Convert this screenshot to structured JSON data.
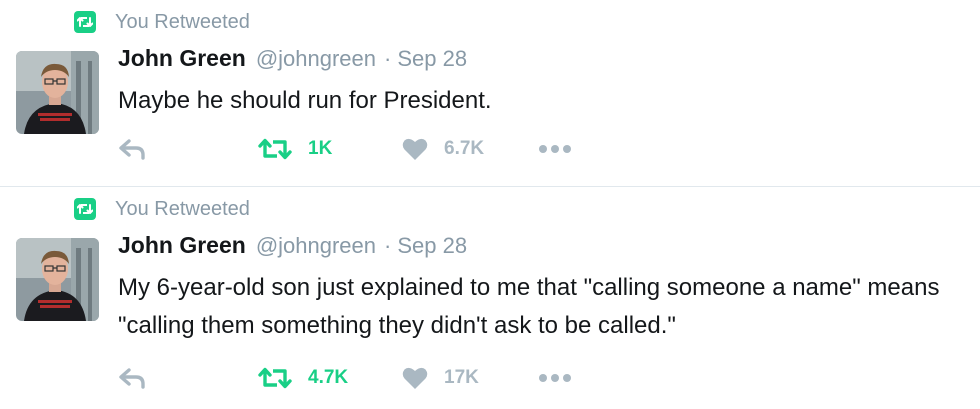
{
  "colors": {
    "retweet_green": "#19cf86",
    "muted": "#8899a6",
    "icon_gray": "#aab8c2",
    "divider": "#e1e8ed",
    "text": "#14171a"
  },
  "tweets": [
    {
      "context_label": "You Retweeted",
      "context_icon": "retweet-badge-icon",
      "fullname": "John Green",
      "username": "@johngreen",
      "separator": "·",
      "time": "Sep 28",
      "text": "Maybe he should run for President.",
      "actions": {
        "reply_icon": "reply-icon",
        "retweet_icon": "retweet-icon",
        "retweet_count": "1K",
        "retweeted": true,
        "like_icon": "heart-icon",
        "like_count": "6.7K",
        "more_icon": "more-dots-icon"
      }
    },
    {
      "context_label": "You Retweeted",
      "context_icon": "retweet-badge-icon",
      "fullname": "John Green",
      "username": "@johngreen",
      "separator": "·",
      "time": "Sep 28",
      "text": "My 6-year-old son just explained to me that \"calling someone a name\" means \"calling them something they didn't ask to be called.\"",
      "actions": {
        "reply_icon": "reply-icon",
        "retweet_icon": "retweet-icon",
        "retweet_count": "4.7K",
        "retweeted": true,
        "like_icon": "heart-icon",
        "like_count": "17K",
        "more_icon": "more-dots-icon"
      }
    }
  ]
}
